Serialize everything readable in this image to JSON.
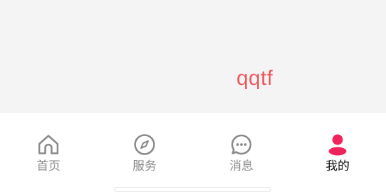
{
  "content": {
    "text": "qqtf",
    "text_color": "#f0555c",
    "background_color": "#f4f4f4"
  },
  "tabbar": {
    "items": [
      {
        "label": "首页",
        "icon": "home-icon",
        "active": false
      },
      {
        "label": "服务",
        "icon": "compass-icon",
        "active": false
      },
      {
        "label": "消息",
        "icon": "chat-bubble-icon",
        "active": false
      },
      {
        "label": "我的",
        "icon": "user-icon",
        "active": true
      }
    ],
    "active_color": "#f0245a",
    "inactive_color": "#8a8a8a"
  }
}
